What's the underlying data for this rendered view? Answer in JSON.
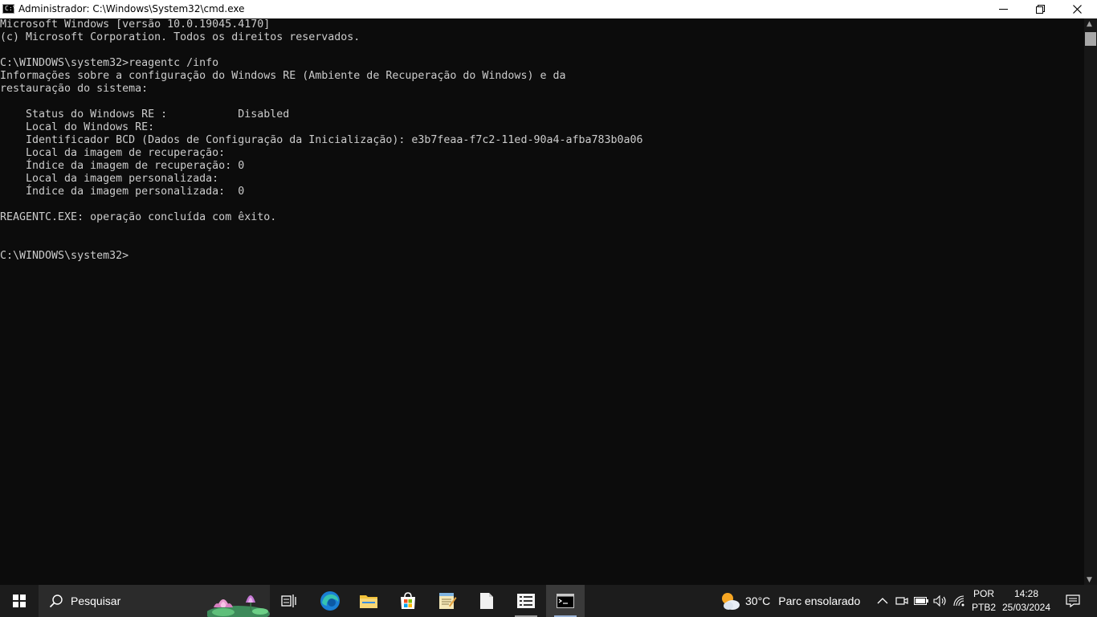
{
  "window": {
    "title": "Administrador: C:\\Windows\\System32\\cmd.exe",
    "icon_label": "C:\\",
    "minimize_glyph": "—",
    "maximize_glyph": "❐",
    "close_glyph": "✕"
  },
  "console": {
    "lines": [
      "Microsoft Windows [versão 10.0.19045.4170]",
      "(c) Microsoft Corporation. Todos os direitos reservados.",
      "",
      "C:\\WINDOWS\\system32>reagentc /info",
      "Informações sobre a configuração do Windows RE (Ambiente de Recuperação do Windows) e da",
      "restauração do sistema:",
      "",
      "    Status do Windows RE :           Disabled",
      "    Local do Windows RE:",
      "    Identificador BCD (Dados de Configuração da Inicialização): e3b7feaa-f7c2-11ed-90a4-afba783b0a06",
      "    Local da imagem de recuperação:",
      "    Índice da imagem de recuperação: 0",
      "    Local da imagem personalizada:",
      "    Índice da imagem personalizada:  0",
      "",
      "REAGENTC.EXE: operação concluída com êxito.",
      "",
      "",
      "C:\\WINDOWS\\system32>"
    ]
  },
  "scrollbar": {
    "up_glyph": "▲",
    "down_glyph": "▼"
  },
  "taskbar": {
    "search_placeholder": "Pesquisar",
    "pinned": [
      {
        "name": "task-view-icon"
      },
      {
        "name": "edge-icon"
      },
      {
        "name": "file-explorer-icon"
      },
      {
        "name": "microsoft-store-icon"
      },
      {
        "name": "notepad-icon"
      },
      {
        "name": "document-icon"
      },
      {
        "name": "list-app-icon"
      },
      {
        "name": "command-prompt-icon"
      }
    ],
    "weather": {
      "icon": "partly-sunny-icon",
      "temperature": "30°C",
      "condition": "Parc ensolarado"
    },
    "tray": {
      "chevron_glyph": "∧"
    },
    "language": {
      "lang": "POR",
      "layout": "PTB2"
    },
    "clock": {
      "time": "14:28",
      "date": "25/03/2024"
    }
  },
  "colors": {
    "console_bg": "#0c0c0c",
    "console_text": "#cccccc",
    "taskbar_bg": "#1c1c1c",
    "titlebar_bg": "#ffffff"
  }
}
